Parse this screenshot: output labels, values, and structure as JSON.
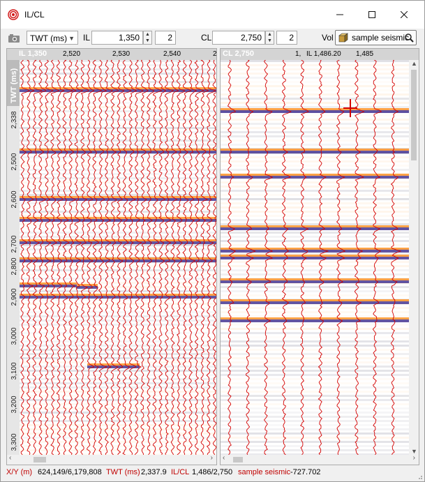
{
  "window": {
    "title": "IL/CL"
  },
  "toolbar": {
    "domain_value": "TWT (ms)",
    "il_label": "IL",
    "il_value": "1,350",
    "il_step": "2",
    "cl_label": "CL",
    "cl_value": "2,750",
    "cl_step": "2",
    "vol_label": "Vol",
    "vol_value": "sample seismic"
  },
  "left_panel": {
    "title": "IL 1,350",
    "ticks": [
      "2,520",
      "2,530",
      "2,540",
      "2"
    ],
    "axis_title": "TWT (ms)",
    "depth_labels": [
      "2,338",
      "2,500",
      "2,600",
      "2,700",
      "2,800",
      "2,900",
      "3,000",
      "3,100",
      "3,200",
      "3,300"
    ]
  },
  "right_panel": {
    "title": "CL 2,750",
    "tick_partial": "1,",
    "cursor_label": "IL 1,486.20",
    "tick": "1,485"
  },
  "status": {
    "xy_label": "X/Y (m)",
    "xy_value": "624,149/6,179,808",
    "twt_label": "TWT (ms)",
    "twt_value": "2,337.9",
    "ilcl_label": "IL/CL",
    "ilcl_value": "1,486/2,750",
    "vol_label": "sample seismic",
    "vol_value": "-727.702"
  },
  "colors": {
    "trace": "#d40000",
    "positive": "#ff8c1a",
    "negative": "#3b2a8c",
    "status_label": "#c00000"
  }
}
